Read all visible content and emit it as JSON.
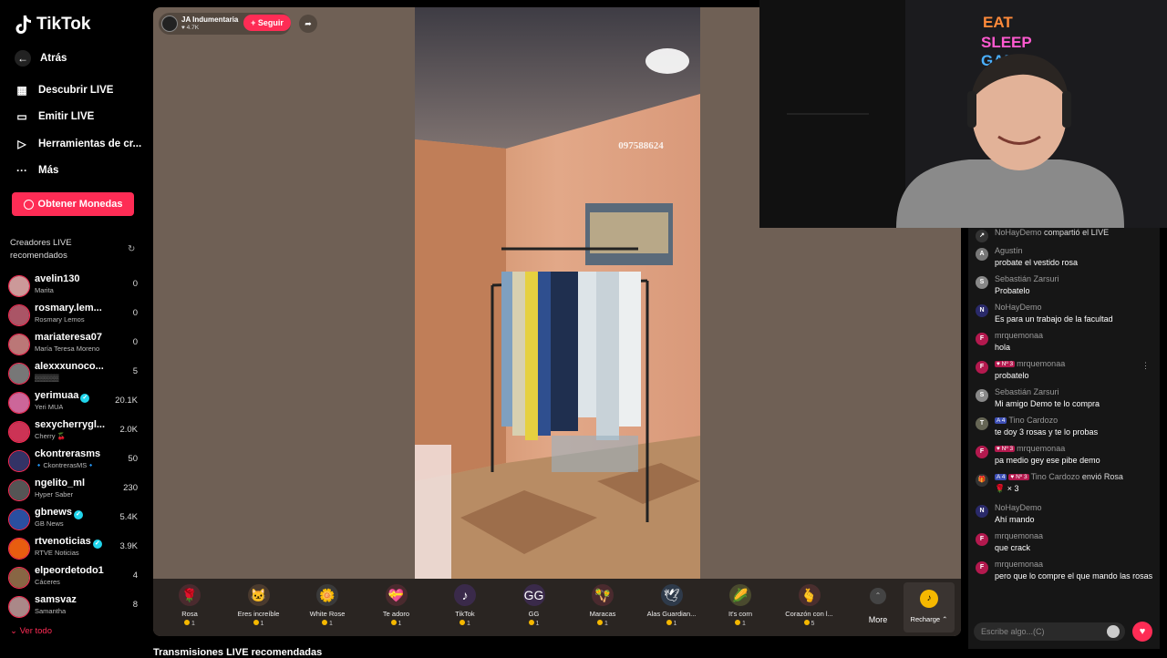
{
  "brand": {
    "name": "TikTok"
  },
  "nav": {
    "back": "Atrás",
    "discover": "Descubrir LIVE",
    "go_live": "Emitir LIVE",
    "creator_tools": "Herramientas de cr...",
    "more": "Más"
  },
  "coins_button": "Obtener Monedas",
  "recommended": {
    "title": "Creadores LIVE recomendados",
    "see_all": "Ver todo",
    "creators": [
      {
        "name": "avelin130",
        "sub": "Marita",
        "count": "0",
        "color": "#c99"
      },
      {
        "name": "rosmary.lem...",
        "sub": "Rosmary Lemos",
        "count": "0",
        "color": "#a56"
      },
      {
        "name": "mariateresa07",
        "sub": "María Teresa Moreno",
        "count": "0",
        "color": "#b77"
      },
      {
        "name": "alexxxunoco...",
        "sub": "▒▒▒▒▒",
        "count": "5",
        "color": "#777"
      },
      {
        "name": "yerimuaa",
        "sub": "Yeri MUA",
        "count": "20.1K",
        "color": "#c69",
        "verified": true
      },
      {
        "name": "sexycherrygl...",
        "sub": "Cherry 🍒",
        "count": "2.0K",
        "color": "#c35"
      },
      {
        "name": "ckontrerasms",
        "sub": "🔹CkontrerasMS🔹",
        "count": "50",
        "color": "#336"
      },
      {
        "name": "ngelito_ml",
        "sub": "Hyper Saber",
        "count": "230",
        "color": "#555"
      },
      {
        "name": "gbnews",
        "sub": "GB News",
        "count": "5.4K",
        "color": "#2a4fa0",
        "verified": true
      },
      {
        "name": "rtvenoticias",
        "sub": "RTVE Noticias",
        "count": "3.9K",
        "color": "#e85d10",
        "verified": true
      },
      {
        "name": "elpeordetodo1",
        "sub": "Cáceres",
        "count": "4",
        "color": "#864"
      },
      {
        "name": "samsvaz",
        "sub": "Samantha",
        "count": "8",
        "color": "#a88"
      }
    ]
  },
  "host": {
    "name": "JA Indumentaria",
    "likes": "4.7K",
    "follow": "+ Seguir"
  },
  "video": {
    "phone_number": "097588624"
  },
  "gifts": [
    {
      "label": "Rosa",
      "price": "1",
      "icon": "🌹",
      "bg": "#4a2a2e"
    },
    {
      "label": "Eres increíble",
      "price": "1",
      "icon": "🐱",
      "bg": "#4a3a2e"
    },
    {
      "label": "White Rose",
      "price": "1",
      "icon": "🌼",
      "bg": "#3a3a3a"
    },
    {
      "label": "Te adoro",
      "price": "1",
      "icon": "💝",
      "bg": "#4a2a2e"
    },
    {
      "label": "TikTok",
      "price": "1",
      "icon": "♪",
      "bg": "#3a2a4a"
    },
    {
      "label": "GG",
      "price": "1",
      "icon": "GG",
      "bg": "#3a2a4a"
    },
    {
      "label": "Maracas",
      "price": "1",
      "icon": "🪇",
      "bg": "#4a2a2e"
    },
    {
      "label": "Alas Guardian...",
      "price": "1",
      "icon": "🕊",
      "bg": "#2e3a4a"
    },
    {
      "label": "It's corn",
      "price": "1",
      "icon": "🌽",
      "bg": "#4a4a2e"
    },
    {
      "label": "Corazón con l...",
      "price": "5",
      "icon": "🫰",
      "bg": "#4a2e2e"
    }
  ],
  "more_label": "More",
  "recharge_label": "Recharge ⌃",
  "below_title": "Transmisiones LIVE recomendadas",
  "chat": {
    "messages": [
      {
        "user": "NoHayDemo",
        "text": "compartió el LIVE",
        "inline": true,
        "avatar": "↗",
        "avbg": "#333"
      },
      {
        "user": "Agustín",
        "text": "probate el vestido rosa",
        "avatar": "A",
        "avbg": "#777"
      },
      {
        "user": "Sebastián Zarsuri",
        "text": "Probatelo",
        "avatar": "S",
        "avbg": "#888"
      },
      {
        "user": "NoHayDemo",
        "text": "Es para un trabajo de la facultad",
        "avatar": "N",
        "avbg": "#2a2a6a"
      },
      {
        "user": "mrquemonaa",
        "text": "hola",
        "avatar": "F",
        "avbg": "#b3194e"
      },
      {
        "user": "mrquemonaa",
        "badge2": "Nº 3",
        "text": "probatelo",
        "avatar": "F",
        "avbg": "#b3194e"
      },
      {
        "user": "Sebastián Zarsuri",
        "text": "Mi amigo Demo te lo compra",
        "avatar": "S",
        "avbg": "#888"
      },
      {
        "user": "Tino Cardozo",
        "badge1": "4",
        "text": "te doy 3 rosas y te lo probas",
        "avatar": "T",
        "avbg": "#665"
      },
      {
        "user": "mrquemonaa",
        "badge2": "Nº 3",
        "text": "pa medio gey ese pibe demo",
        "avatar": "F",
        "avbg": "#b3194e"
      },
      {
        "user": "Tino Cardozo",
        "badge1": "4",
        "badge2": "Nº 3",
        "suffix": "envió Rosa",
        "text": "🌹 × 3",
        "avatar": "🎁",
        "avbg": "#333"
      },
      {
        "user": "NoHayDemo",
        "text": "Ahí mando",
        "avatar": "N",
        "avbg": "#2a2a6a"
      },
      {
        "user": "mrquemonaa",
        "text": "que crack",
        "avatar": "F",
        "avbg": "#b3194e"
      },
      {
        "user": "mrquemonaa",
        "text": "pero que lo compre el que mando las rosas",
        "avatar": "F",
        "avbg": "#b3194e"
      }
    ],
    "input_placeholder": "Escribe algo...(C)"
  },
  "webcam": {
    "neon_line1": "EAT",
    "neon_line2": "SLEEP",
    "neon_line3": "GAME"
  }
}
